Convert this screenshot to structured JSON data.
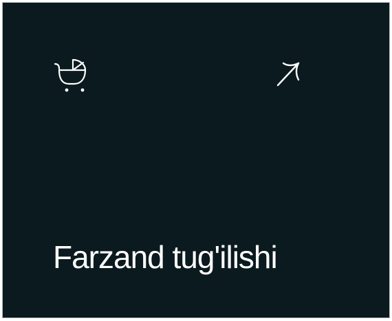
{
  "card": {
    "title": "Farzand tug'ilishi",
    "icon": "baby-stroller-icon",
    "action_icon": "arrow-up-right-icon",
    "background_color": "#0b1a1f",
    "foreground_color": "#ffffff"
  }
}
